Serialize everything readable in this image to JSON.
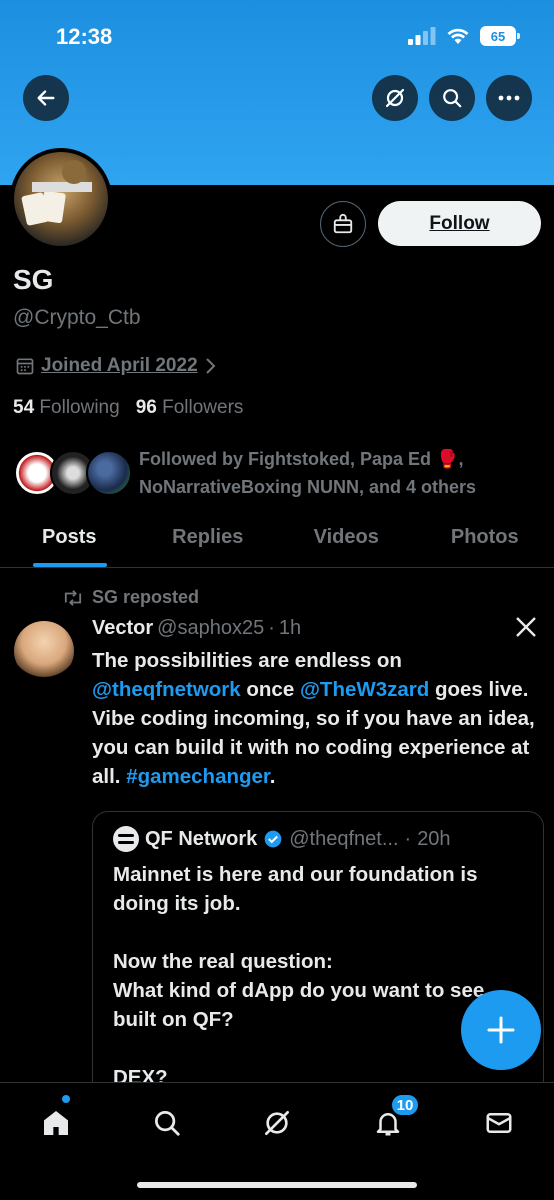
{
  "status_bar": {
    "time": "12:38",
    "battery": "65"
  },
  "profile": {
    "name": "SG",
    "handle": "@Crypto_Ctb",
    "joined": "Joined April 2022",
    "following_count": "54",
    "following_label": "Following",
    "followers_count": "96",
    "followers_label": "Followers",
    "follow_button": "Follow",
    "followed_by": "Followed by Fightstoked, Papa Ed 🥊, NoNarrativeBoxing NUNN, and 4 others"
  },
  "tabs": [
    {
      "label": "Posts"
    },
    {
      "label": "Replies"
    },
    {
      "label": "Videos"
    },
    {
      "label": "Photos"
    }
  ],
  "post": {
    "repost_label": "SG reposted",
    "author_name": "Vector",
    "author_handle": "@saphox25",
    "separator": "·",
    "time": "1h",
    "body_1": "The possibilities are endless on ",
    "mention_1": "@theqfnetwork",
    "body_2": " once ",
    "mention_2": "@TheW3zard",
    "body_3": " goes live. Vibe coding incoming, so if you have an idea, you can build it with no coding experience at all. ",
    "hashtag": "#gamechanger",
    "body_4": ".",
    "quote": {
      "author_name": "QF Network",
      "author_handle": "@theqfnet...",
      "separator": "·",
      "time": "20h",
      "body": "Mainnet is here and our foundation is doing its job.\n\nNow the real question:\nWhat kind of dApp do you want to see built on QF?\n\nDEX?"
    }
  },
  "bottom_nav": {
    "notifications_badge": "10"
  },
  "colors": {
    "accent": "#1d9bf0",
    "banner": "#2fa4f0",
    "muted": "#71767b",
    "text": "#e7e9ea"
  }
}
